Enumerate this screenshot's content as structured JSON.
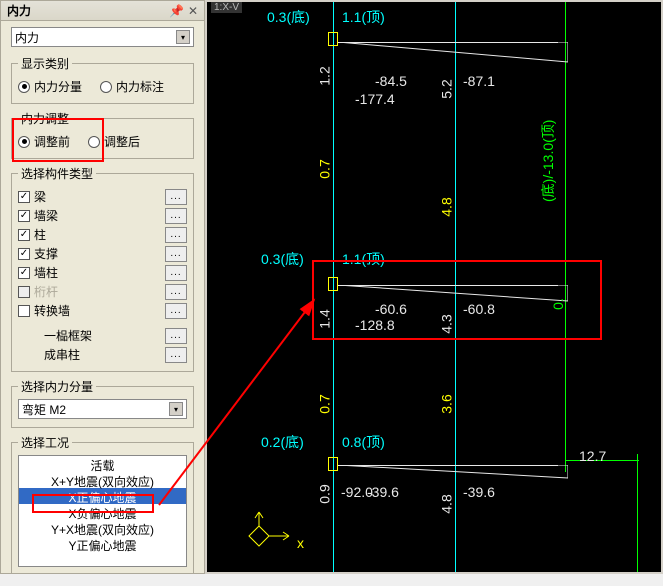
{
  "panel_title": "内力",
  "titlebar_icons": {
    "pin": "📌",
    "close": "✕"
  },
  "main_dropdown": {
    "value": "内力",
    "chev": "▾"
  },
  "display_type": {
    "legend": "显示类别",
    "opt1": "内力分量",
    "opt2": "内力标注"
  },
  "adjust": {
    "legend": "内力调整",
    "opt1": "调整前",
    "opt2": "调整后"
  },
  "members": {
    "legend": "选择构件类型",
    "items": [
      {
        "label": "梁",
        "checked": true
      },
      {
        "label": "墙梁",
        "checked": true
      },
      {
        "label": "柱",
        "checked": true
      },
      {
        "label": "支撑",
        "checked": true
      },
      {
        "label": "墙柱",
        "checked": true
      },
      {
        "label": "桁杆",
        "checked": false,
        "disabled": true
      },
      {
        "label": "转换墙",
        "checked": false
      }
    ],
    "extra1": "一榀框架",
    "extra2": "成串柱",
    "dots": "..."
  },
  "component": {
    "legend": "选择内力分量",
    "value": "弯矩 M2",
    "chev": "▾"
  },
  "loadcase": {
    "legend": "选择工况",
    "items": [
      "活载",
      "X+Y地震(双向效应)",
      "X正偏心地震",
      "X负偏心地震",
      "Y+X地震(双向效应)",
      "Y正偏心地震"
    ],
    "selected_index": 2
  },
  "viewport": {
    "tab": "1:X-V",
    "section1": {
      "bottom": "0.3(底)",
      "top": "1.1(顶)",
      "left_axial": "1.2",
      "right_axial": "5.2",
      "m_left": "-84.5",
      "m_right": "-87.1",
      "m_total": "-177.4"
    },
    "section2": {
      "bottom": "0.3(底)",
      "top": "1.1(顶)",
      "left_v": "0.7",
      "right_v": "3.6",
      "right_mid": "4.8",
      "left_axial": "1.4",
      "right_axial": "4.3",
      "m_left": "-60.6",
      "m_right": "-60.8",
      "m_total": "-128.8",
      "top_annot": "(底)/-13.0(顶)",
      "top_right": "0."
    },
    "section3": {
      "bottom": "0.2(底)",
      "top": "0.8(顶)",
      "left_v": "0.7",
      "right_v": "3.6",
      "left_axial": "0.9",
      "right_axial": "4.8",
      "m_left": "-39.6",
      "m_right": "-39.6",
      "m_total": "-92.0",
      "far_right": "12.7"
    },
    "axis_x": "x"
  }
}
